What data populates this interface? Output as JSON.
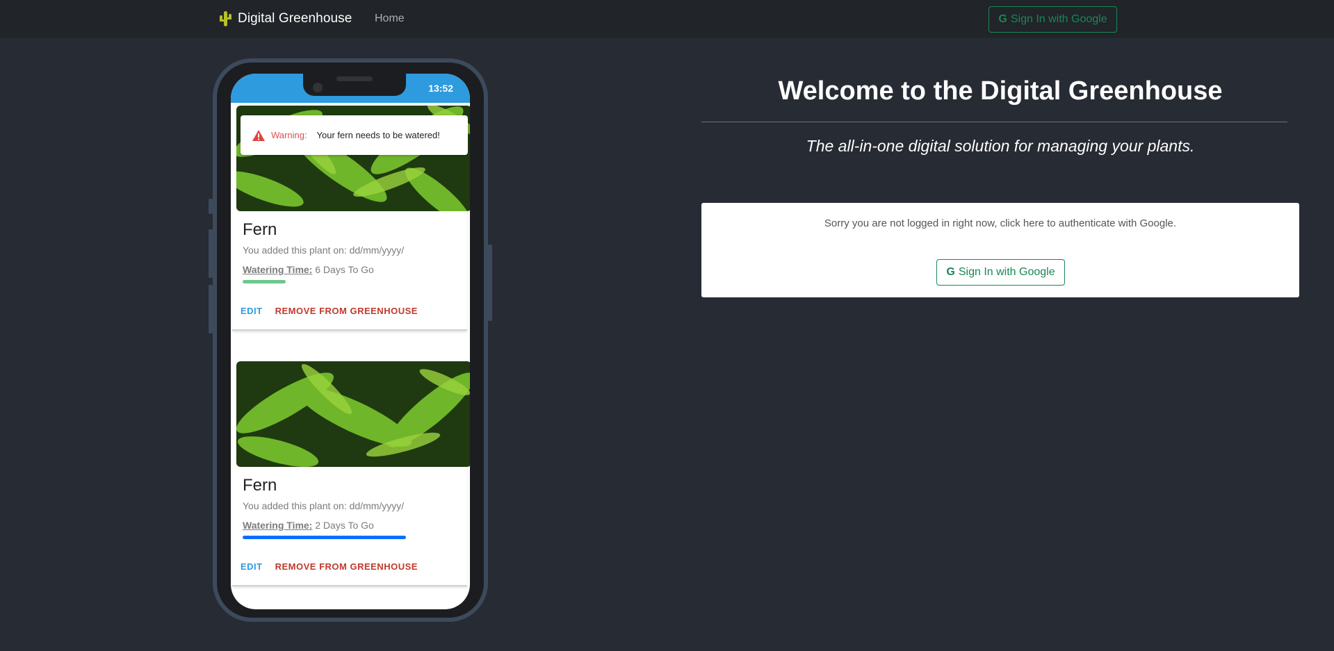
{
  "navbar": {
    "brand": "Digital Greenhouse",
    "brand_icon": "cactus-icon",
    "home_label": "Home",
    "signin_label": "Sign In with Google"
  },
  "phone": {
    "time": "13:52",
    "warning": {
      "label": "Warning:",
      "message": "Your fern needs to be watered!"
    },
    "cards": [
      {
        "title": "Fern",
        "added": "You added this plant on: dd/mm/yyyy/",
        "watering_label": "Watering Time:",
        "watering_value": " 6 Days To Go",
        "progress": 0.22,
        "progress_color": "#6cc98a",
        "edit_label": "EDIT",
        "remove_label": "REMOVE FROM GREENHOUSE"
      },
      {
        "title": "Fern",
        "added": "You added this plant on: dd/mm/yyyy/",
        "watering_label": "Watering Time:",
        "watering_value": " 2 Days To Go",
        "progress": 0.83,
        "progress_color": "#0d6efd",
        "edit_label": "EDIT",
        "remove_label": "REMOVE FROM GREENHOUSE"
      }
    ]
  },
  "main": {
    "title": "Welcome to the Digital Greenhouse",
    "tagline": "The all-in-one digital solution for managing your plants.",
    "login_message": "Sorry you are not logged in right now, click here to authenticate with Google.",
    "signin_label": "Sign In with Google"
  },
  "colors": {
    "background": "#272b34",
    "navbar": "#212429",
    "accent_green": "#198754",
    "status_blue": "#2d9bde"
  }
}
